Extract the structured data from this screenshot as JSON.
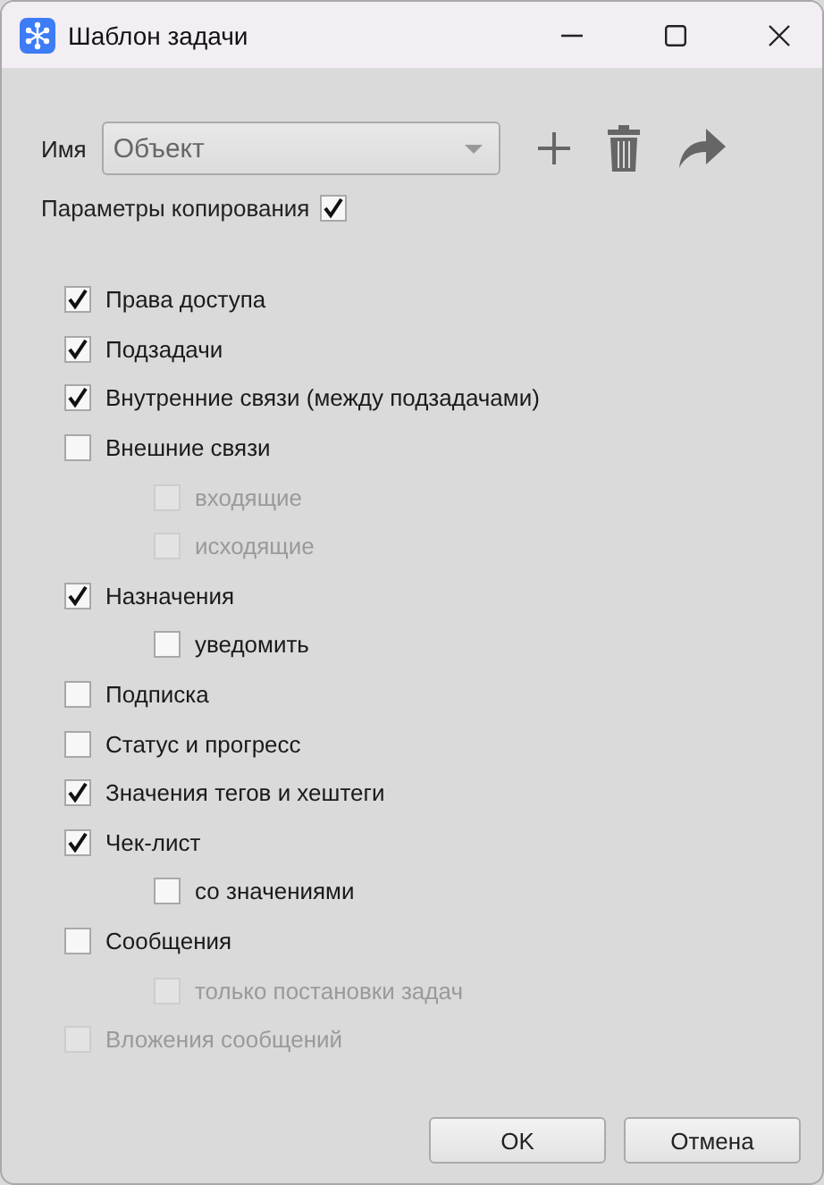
{
  "window": {
    "title": "Шаблон задачи"
  },
  "name_field": {
    "label": "Имя",
    "value": "Объект"
  },
  "copy_params": {
    "label": "Параметры копирования",
    "checked": true
  },
  "options": [
    {
      "label": "Права доступа",
      "checked": true,
      "disabled": false
    },
    {
      "label": "Подзадачи",
      "checked": true,
      "disabled": false
    },
    {
      "label": "Внутренние связи (между подзадачами)",
      "checked": true,
      "disabled": false
    },
    {
      "label": "Внешние связи",
      "checked": false,
      "disabled": false,
      "children": [
        {
          "label": "входящие",
          "checked": false,
          "disabled": true
        },
        {
          "label": "исходящие",
          "checked": false,
          "disabled": true
        }
      ]
    },
    {
      "label": "Назначения",
      "checked": true,
      "disabled": false,
      "children": [
        {
          "label": "уведомить",
          "checked": false,
          "disabled": false
        }
      ]
    },
    {
      "label": "Подписка",
      "checked": false,
      "disabled": false
    },
    {
      "label": "Статус и прогресс",
      "checked": false,
      "disabled": false
    },
    {
      "label": "Значения тегов и хештеги",
      "checked": true,
      "disabled": false
    },
    {
      "label": "Чек-лист",
      "checked": true,
      "disabled": false,
      "children": [
        {
          "label": "со значениями",
          "checked": false,
          "disabled": false
        }
      ]
    },
    {
      "label": "Сообщения",
      "checked": false,
      "disabled": false,
      "children": [
        {
          "label": "только постановки задач",
          "checked": false,
          "disabled": true
        }
      ]
    },
    {
      "label": "Вложения сообщений",
      "checked": false,
      "disabled": true
    }
  ],
  "buttons": [
    "OK",
    "Отмена"
  ]
}
